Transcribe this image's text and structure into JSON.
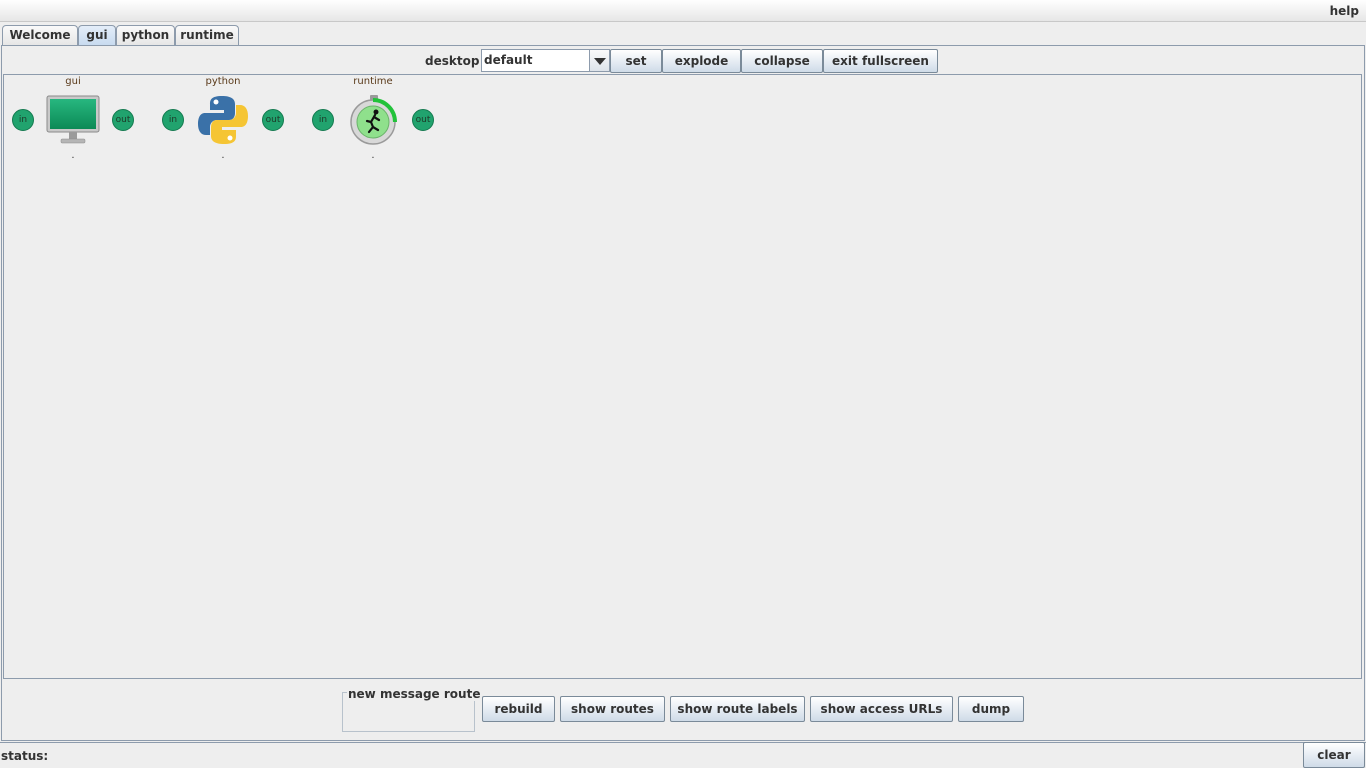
{
  "menu": {
    "help": "help"
  },
  "tabs": [
    {
      "label": "Welcome",
      "selected": false
    },
    {
      "label": "gui",
      "selected": true
    },
    {
      "label": "python",
      "selected": false
    },
    {
      "label": "runtime",
      "selected": false
    }
  ],
  "toolbar": {
    "desktop_label": "desktop",
    "desktop_value": "default",
    "set": "set",
    "explode": "explode",
    "collapse": "collapse",
    "exit_fullscreen": "exit fullscreen"
  },
  "nodes": [
    {
      "title": "gui",
      "in": "in",
      "out": "out",
      "status": ".",
      "icon": "monitor-icon"
    },
    {
      "title": "python",
      "in": "in",
      "out": "out",
      "status": ".",
      "icon": "python-logo-icon"
    },
    {
      "title": "runtime",
      "in": "in",
      "out": "out",
      "status": ".",
      "icon": "stopwatch-runner-icon"
    }
  ],
  "bottom": {
    "route_title": "new message route",
    "rebuild": "rebuild",
    "show_routes": "show routes",
    "show_route_labels": "show route labels",
    "show_access_urls": "show access URLs",
    "dump": "dump"
  },
  "status": {
    "label": "status:",
    "clear": "clear"
  },
  "colors": {
    "port_green": "#21a36e",
    "tab_selected": "#c8dbef",
    "background": "#eeeeee"
  }
}
